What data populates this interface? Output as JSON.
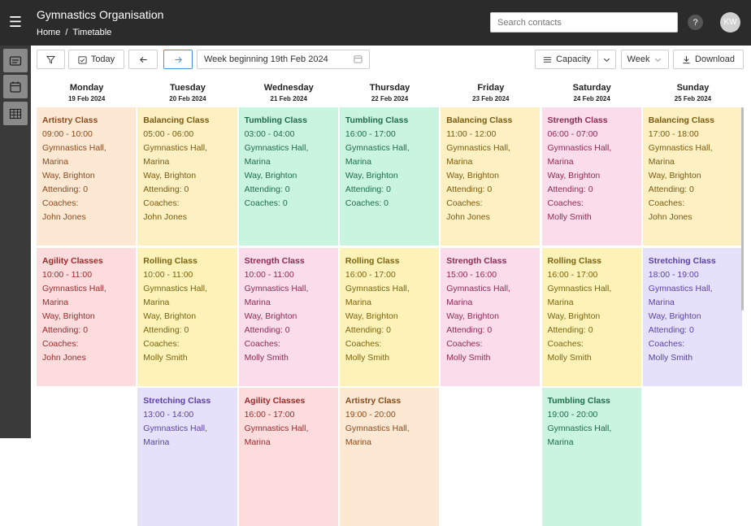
{
  "header": {
    "org_title": "Gymnastics Organisation",
    "breadcrumb": [
      "Home",
      "/",
      "Timetable"
    ],
    "search_placeholder": "Search contacts",
    "help_label": "?",
    "avatar_initials": "KW"
  },
  "toolbar": {
    "filter_icon": "filter-icon",
    "today_label": "Today",
    "prev_icon": "arrow-left-icon",
    "next_icon": "arrow-right-icon",
    "week_label": "Week beginning",
    "week_value": "19th Feb 2024",
    "capacity_label": "Capacity",
    "view_label": "Week",
    "download_label": "Download"
  },
  "rail": [
    "list-view-icon",
    "calendar-icon",
    "table-icon"
  ],
  "days": [
    {
      "name": "Monday",
      "date": "19 Feb 2024"
    },
    {
      "name": "Tuesday",
      "date": "20 Feb 2024"
    },
    {
      "name": "Wednesday",
      "date": "21 Feb 2024"
    },
    {
      "name": "Thursday",
      "date": "22 Feb 2024"
    },
    {
      "name": "Friday",
      "date": "23 Feb 2024"
    },
    {
      "name": "Saturday",
      "date": "24 Feb 2024"
    },
    {
      "name": "Sunday",
      "date": "25 Feb 2024"
    }
  ],
  "colors": {
    "artistry": {
      "bg": "#fde8d4",
      "fg": "#8a4a1a"
    },
    "balancing": {
      "bg": "#fdf0c2",
      "fg": "#7a5a10"
    },
    "tumbling": {
      "bg": "#c9f4e0",
      "fg": "#1f6b48"
    },
    "strength": {
      "bg": "#fbdcea",
      "fg": "#8c2a55"
    },
    "agility": {
      "bg": "#fcdcdc",
      "fg": "#9a2a2a"
    },
    "rolling": {
      "bg": "#fdf3b8",
      "fg": "#7a6210"
    },
    "stretching": {
      "bg": "#e6e1fb",
      "fg": "#5a3fa8"
    }
  },
  "rows": [
    [
      {
        "type": "artistry",
        "name": "Artistry Class",
        "time": "09:00 - 10:00",
        "loc1": "Gymnastics Hall, Marina",
        "loc2": "Way, Brighton",
        "attending": "Attending: 0",
        "coaches": "Coaches:",
        "coach": "John Jones"
      },
      {
        "type": "balancing",
        "name": "Balancing Class",
        "time": "05:00 - 06:00",
        "loc1": "Gymnastics Hall, Marina",
        "loc2": "Way, Brighton",
        "attending": "Attending: 0",
        "coaches": "Coaches:",
        "coach": "John Jones"
      },
      {
        "type": "tumbling",
        "name": "Tumbling Class",
        "time": "03:00 - 04:00",
        "loc1": "Gymnastics Hall, Marina",
        "loc2": "Way, Brighton",
        "attending": "Attending: 0",
        "coaches": "Coaches: 0",
        "coach": ""
      },
      {
        "type": "tumbling",
        "name": "Tumbling Class",
        "time": "16:00 - 17:00",
        "loc1": "Gymnastics Hall, Marina",
        "loc2": "Way, Brighton",
        "attending": "Attending: 0",
        "coaches": "Coaches: 0",
        "coach": ""
      },
      {
        "type": "balancing",
        "name": "Balancing Class",
        "time": "11:00 - 12:00",
        "loc1": "Gymnastics Hall, Marina",
        "loc2": "Way, Brighton",
        "attending": "Attending: 0",
        "coaches": "Coaches:",
        "coach": "John Jones"
      },
      {
        "type": "strength",
        "name": "Strength Class",
        "time": "06:00 - 07:00",
        "loc1": "Gymnastics Hall, Marina",
        "loc2": "Way, Brighton",
        "attending": "Attending: 0",
        "coaches": "Coaches:",
        "coach": "Molly Smith"
      },
      {
        "type": "balancing",
        "name": "Balancing Class",
        "time": "17:00 - 18:00",
        "loc1": "Gymnastics Hall, Marina",
        "loc2": "Way, Brighton",
        "attending": "Attending: 0",
        "coaches": "Coaches:",
        "coach": "John Jones"
      }
    ],
    [
      {
        "type": "agility",
        "name": "Agility Classes",
        "time": "10:00 - 11:00",
        "loc1": "Gymnastics Hall, Marina",
        "loc2": "Way, Brighton",
        "attending": "Attending: 0",
        "coaches": "Coaches:",
        "coach": "John Jones"
      },
      {
        "type": "rolling",
        "name": "Rolling Class",
        "time": "10:00 - 11:00",
        "loc1": "Gymnastics Hall, Marina",
        "loc2": "Way, Brighton",
        "attending": "Attending: 0",
        "coaches": "Coaches:",
        "coach": "Molly Smith"
      },
      {
        "type": "strength",
        "name": "Strength Class",
        "time": "10:00 - 11:00",
        "loc1": "Gymnastics Hall, Marina",
        "loc2": "Way, Brighton",
        "attending": "Attending: 0",
        "coaches": "Coaches:",
        "coach": "Molly Smith"
      },
      {
        "type": "rolling",
        "name": "Rolling Class",
        "time": "16:00 - 17:00",
        "loc1": "Gymnastics Hall, Marina",
        "loc2": "Way, Brighton",
        "attending": "Attending: 0",
        "coaches": "Coaches:",
        "coach": "Molly Smith"
      },
      {
        "type": "strength",
        "name": "Strength Class",
        "time": "15:00 - 16:00",
        "loc1": "Gymnastics Hall, Marina",
        "loc2": "Way, Brighton",
        "attending": "Attending: 0",
        "coaches": "Coaches:",
        "coach": "Molly Smith"
      },
      {
        "type": "rolling",
        "name": "Rolling Class",
        "time": "16:00 - 17:00",
        "loc1": "Gymnastics Hall, Marina",
        "loc2": "Way, Brighton",
        "attending": "Attending: 0",
        "coaches": "Coaches:",
        "coach": "Molly Smith"
      },
      {
        "type": "stretching",
        "name": "Stretching Class",
        "time": "18:00 - 19:00",
        "loc1": "Gymnastics Hall, Marina",
        "loc2": "Way, Brighton",
        "attending": "Attending: 0",
        "coaches": "Coaches:",
        "coach": "Molly Smith"
      }
    ],
    [
      null,
      {
        "type": "stretching",
        "name": "Stretching Class",
        "time": "13:00 - 14:00",
        "loc1": "Gymnastics Hall, Marina",
        "loc2": "",
        "attending": "",
        "coaches": "",
        "coach": ""
      },
      {
        "type": "agility",
        "name": "Agility Classes",
        "time": "16:00 - 17:00",
        "loc1": "Gymnastics Hall, Marina",
        "loc2": "",
        "attending": "",
        "coaches": "",
        "coach": ""
      },
      {
        "type": "artistry",
        "name": "Artistry Class",
        "time": "19:00 - 20:00",
        "loc1": "Gymnastics Hall, Marina",
        "loc2": "",
        "attending": "",
        "coaches": "",
        "coach": ""
      },
      null,
      {
        "type": "tumbling",
        "name": "Tumbling Class",
        "time": "19:00 - 20:00",
        "loc1": "Gymnastics Hall, Marina",
        "loc2": "",
        "attending": "",
        "coaches": "",
        "coach": ""
      },
      null
    ]
  ]
}
